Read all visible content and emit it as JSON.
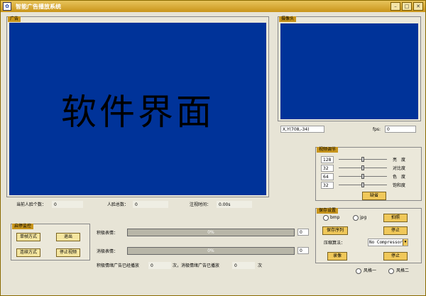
{
  "window": {
    "title": "智能广告播放系统"
  },
  "ad_panel": {
    "label": "广告",
    "overlay_text": "软件界面"
  },
  "camera_panel": {
    "label": "摄像头",
    "coords": "X,Y(708,-34)",
    "fps_label": "fps:",
    "fps_value": "0"
  },
  "stats": {
    "current_faces_label": "当前人脸个数：",
    "current_faces_value": "0",
    "total_faces_label": "人脸总数：",
    "total_faces_value": "0",
    "view_time_label": "注视时间：",
    "view_time_value": "0.00s"
  },
  "video_adjust": {
    "label": "视频调节",
    "rows": [
      {
        "value": "128",
        "label": "亮　度",
        "pos": 0.5
      },
      {
        "value": "32",
        "label": "对比度",
        "pos": 0.5
      },
      {
        "value": "64",
        "label": "色　度",
        "pos": 0.5
      },
      {
        "value": "32",
        "label": "饱和度",
        "pos": 0.5
      }
    ],
    "default_button": "缺省"
  },
  "monitor": {
    "label": "启停监控",
    "single_frame": "单帧方式",
    "exit": "退出",
    "continuous": "连续方式",
    "stop_video": "停止视频"
  },
  "expressions": {
    "positive_label": "积极表情：",
    "positive_progress": "0%",
    "positive_count": "0",
    "negative_label": "消极表情：",
    "negative_progress": "0%",
    "negative_count": "0",
    "summary_prefix": "积极情绪广告已经播放",
    "summary_positive": "0",
    "summary_mid": "次，消极情绪广告已播放",
    "summary_negative": "0",
    "summary_suffix": "次"
  },
  "save_settings": {
    "label": "保存设置",
    "bmp": "bmp",
    "jpg": "jpg",
    "photo": "拍照",
    "save_sequence": "保存序列",
    "stop1": "停止",
    "compression_label": "压缩算法：",
    "compression_value": "No Compressor",
    "record": "录像",
    "stop2": "停止"
  },
  "style": {
    "style1": "风格一",
    "style2": "风格二"
  }
}
